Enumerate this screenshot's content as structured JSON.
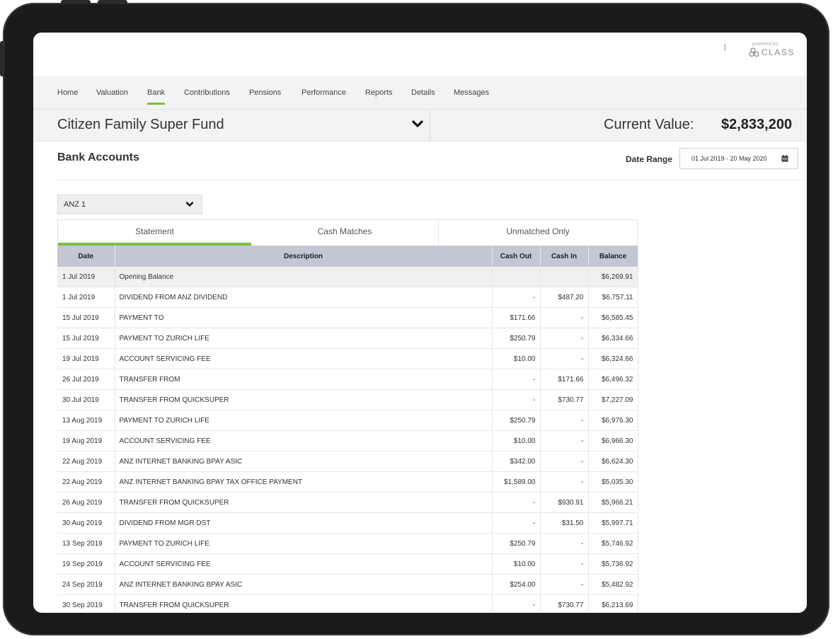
{
  "branding": {
    "powered_by": "powered by",
    "logo_text": "CLASS"
  },
  "nav": {
    "items": [
      "Home",
      "Valuation",
      "Bank",
      "Contributions",
      "Pensions",
      "Performance",
      "Reports",
      "Details",
      "Messages"
    ],
    "active": "Bank"
  },
  "fund": {
    "name": "Citizen Family Super Fund",
    "current_value_label": "Current Value:",
    "current_value": "$2,833,200"
  },
  "bank": {
    "title": "Bank Accounts",
    "date_range_label": "Date Range",
    "date_range_value": "01 Jul 2019 - 20 May 2020",
    "account_selected": "ANZ 1"
  },
  "tabs": [
    "Statement",
    "Cash Matches",
    "Unmatched Only"
  ],
  "table": {
    "columns": [
      "Date",
      "Description",
      "Cash Out",
      "Cash In",
      "Balance"
    ],
    "rows": [
      [
        "1 Jul 2019",
        "Opening Balance",
        "",
        "",
        "$6,269.91"
      ],
      [
        "1 Jul 2019",
        "DIVIDEND FROM ANZ DIVIDEND",
        "-",
        "$487.20",
        "$6,757.11"
      ],
      [
        "15 Jul 2019",
        "PAYMENT TO",
        "$171.66",
        "-",
        "$6,585.45"
      ],
      [
        "15 Jul 2019",
        "PAYMENT TO ZURICH LIFE",
        "$250.79",
        "-",
        "$6,334.66"
      ],
      [
        "19 Jul 2019",
        "ACCOUNT SERVICING FEE",
        "$10.00",
        "-",
        "$6,324.66"
      ],
      [
        "26 Jul 2019",
        "TRANSFER FROM",
        "-",
        "$171.66",
        "$6,496.32"
      ],
      [
        "30 Jul 2019",
        "TRANSFER FROM QUICKSUPER",
        "-",
        "$730.77",
        "$7,227.09"
      ],
      [
        "13 Aug 2019",
        "PAYMENT TO ZURICH LIFE",
        "$250.79",
        "-",
        "$6,976.30"
      ],
      [
        "19 Aug 2019",
        "ACCOUNT SERVICING FEE",
        "$10.00",
        "-",
        "$6,966.30"
      ],
      [
        "22 Aug 2019",
        "ANZ INTERNET BANKING BPAY ASIC",
        "$342.00",
        "-",
        "$6,624.30"
      ],
      [
        "22 Aug 2019",
        "ANZ INTERNET BANKING BPAY TAX OFFICE PAYMENT",
        "$1,589.00",
        "-",
        "$5,035.30"
      ],
      [
        "26 Aug 2019",
        "TRANSFER FROM QUICKSUPER",
        "-",
        "$930.91",
        "$5,966.21"
      ],
      [
        "30 Aug 2019",
        "DIVIDEND FROM MGR DST",
        "-",
        "$31.50",
        "$5,997.71"
      ],
      [
        "13 Sep 2019",
        "PAYMENT TO ZURICH LIFE",
        "$250.79",
        "-",
        "$5,746.92"
      ],
      [
        "19 Sep 2019",
        "ACCOUNT SERVICING FEE",
        "$10.00",
        "-",
        "$5,736.92"
      ],
      [
        "24 Sep 2019",
        "ANZ INTERNET BANKING BPAY ASIC",
        "$254.00",
        "-",
        "$5,482.92"
      ],
      [
        "30 Sep 2019",
        "TRANSFER FROM QUICKSUPER",
        "-",
        "$730.77",
        "$6,213.69"
      ]
    ]
  },
  "colors": {
    "accent": "#7bbf3f",
    "table_header": "#c4c7d3",
    "device_frame": "#1b1b1b"
  }
}
